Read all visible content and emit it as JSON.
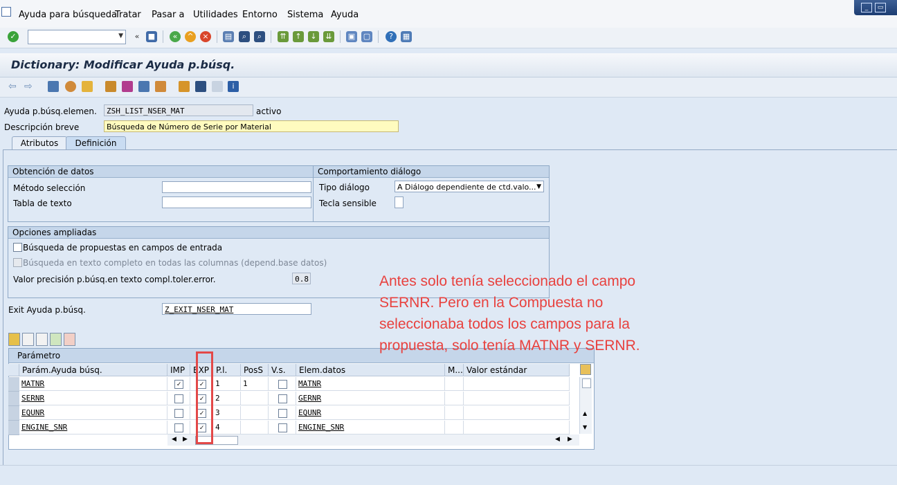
{
  "menubar": {
    "items": [
      "Ayuda para búsqueda",
      "Tratar",
      "Pasar a",
      "Utilidades",
      "Entorno",
      "Sistema",
      "Ayuda"
    ]
  },
  "icons": {
    "toolbar1": [
      "enter-icon",
      "back-icon",
      "save-icon",
      "back-green-icon",
      "exit-icon",
      "cancel-icon",
      "print-icon",
      "find-icon",
      "find-next-icon",
      "first-page-icon",
      "prev-page-icon",
      "next-page-icon",
      "last-page-icon",
      "new-session-icon",
      "shortcut-icon",
      "help-icon",
      "customize-icon"
    ],
    "toolbar2": [
      "back-arrow-icon",
      "forward-arrow-icon",
      "display-change-icon",
      "other-object-icon",
      "activate-icon",
      "where-used-icon",
      "test-icon",
      "attributes-icon",
      "where-used-list-icon",
      "hierarchy-icon",
      "align-icon",
      "layout-icon",
      "info-icon"
    ]
  },
  "header": {
    "title": "Dictionary: Modificar Ayuda p.búsq."
  },
  "form": {
    "elem_label": "Ayuda p.búsq.elemen.",
    "elem_value": "ZSH_LIST_NSER_MAT",
    "elem_status": "activo",
    "desc_label": "Descripción breve",
    "desc_value": "Búsqueda de Número de Serie por Material"
  },
  "tabs": [
    "Atributos",
    "Definición"
  ],
  "obtencion": {
    "title": "Obtención de datos",
    "metodo_label": "Método selección",
    "tabla_label": "Tabla de texto"
  },
  "comportamiento": {
    "title": "Comportamiento diálogo",
    "tipo_label": "Tipo diálogo",
    "tipo_value": "A Diálogo dependiente de ctd.valo...",
    "tecla_label": "Tecla sensible"
  },
  "opciones": {
    "title": "Opciones ampliadas",
    "opt1": "Búsqueda de propuestas en campos de entrada",
    "opt2": "Búsqueda en texto completo en todas las columnas (depend.base datos)",
    "precision_label": "Valor precisión p.búsq.en texto compl.toler.error.",
    "precision_value": "0.8"
  },
  "exit": {
    "label": "Exit Ayuda p.búsq.",
    "value": "Z_EXIT_NSER_MAT"
  },
  "table": {
    "title": "Parámetro",
    "columns": [
      "Parám.Ayuda búsq.",
      "IMP",
      "EXP",
      "P.l.",
      "PosS",
      "V.s.",
      "Elem.datos",
      "M...",
      "Valor estándar"
    ],
    "rows": [
      {
        "param": "MATNR",
        "imp": true,
        "exp": true,
        "pl": "1",
        "poss": "1",
        "vs": false,
        "elem": "MATNR"
      },
      {
        "param": "SERNR",
        "imp": false,
        "exp": true,
        "pl": "2",
        "poss": "",
        "vs": false,
        "elem": "GERNR"
      },
      {
        "param": "EQUNR",
        "imp": false,
        "exp": true,
        "pl": "3",
        "poss": "",
        "vs": false,
        "elem": "EQUNR"
      },
      {
        "param": "ENGINE_SNR",
        "imp": false,
        "exp": true,
        "pl": "4",
        "poss": "",
        "vs": false,
        "elem": "ENGINE_SNR"
      }
    ]
  },
  "annotation": {
    "text": "Antes solo tenía seleccionado el campo SERNR. Pero en la Compuesta no seleccionaba todos los campos para la propuesta, solo tenía MATNR y SERNR.",
    "color": "#e8413e"
  },
  "colors": {
    "highlight_box": "#e34848",
    "accent": "#c5d6ea"
  }
}
